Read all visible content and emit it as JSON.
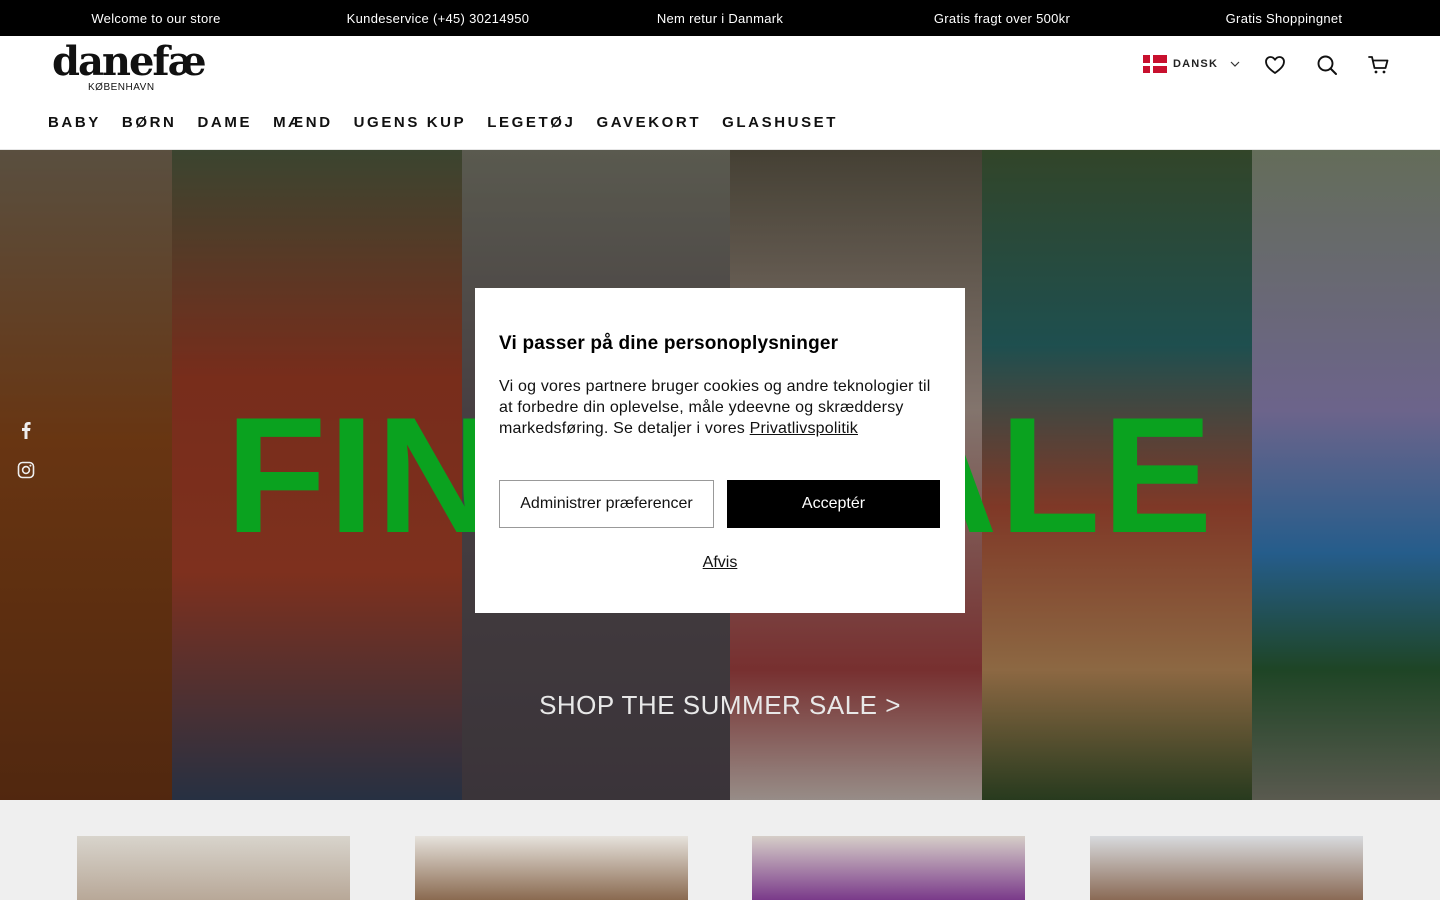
{
  "announcement": {
    "items": [
      "Welcome to our store",
      "Kundeservice (+45) 30214950",
      "Nem retur i Danmark",
      "Gratis fragt over 500kr",
      "Gratis Shoppingnet"
    ]
  },
  "header": {
    "logo": {
      "word": "danefæ",
      "sub": "KØBENHAVN"
    },
    "language": "DANSK",
    "icons": [
      "wishlist-heart-icon",
      "search-icon",
      "cart-icon"
    ]
  },
  "nav": {
    "items": [
      "BABY",
      "BØRN",
      "DAME",
      "MÆND",
      "UGENS KUP",
      "LEGETØJ",
      "GAVEKORT",
      "GLASHUSET"
    ]
  },
  "hero": {
    "title": "FINAL SALE",
    "cta": "SHOP THE SUMMER SALE >",
    "social": [
      "facebook-icon",
      "instagram-icon"
    ],
    "colors": {
      "title": "#0aa21f"
    }
  },
  "cookie_modal": {
    "title": "Vi passer på dine personoplysninger",
    "body": "Vi og vores partnere bruger cookies og andre teknologier til at forbedre din oplevelse, måle ydeevne og skræddersy markedsføring. Se detaljer i vores",
    "link": "Privatlivspolitik",
    "preferences_button": "Administrer præferencer",
    "accept_button": "Acceptér",
    "reject_link": "Afvis"
  }
}
